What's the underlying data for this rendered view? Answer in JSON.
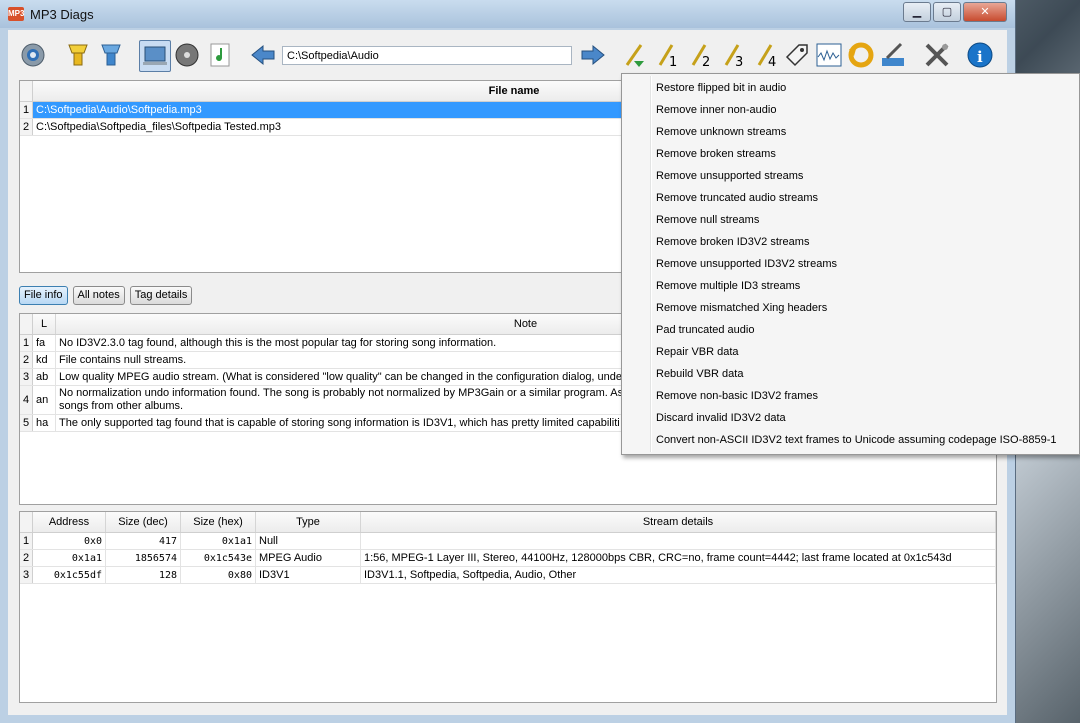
{
  "window": {
    "title": "MP3 Diags",
    "app_icon_text": "MP3"
  },
  "toolbar": {
    "path": "C:\\Softpedia\\Audio",
    "buttons": [
      "config-icon",
      "scan-folder-icon",
      "scan-files-icon",
      "all-files-icon",
      "album-icon",
      "song-icon",
      "back-arrow-icon",
      "forward-arrow-icon",
      "normalize-icon",
      "transform-1-icon",
      "transform-2-icon",
      "transform-3-icon",
      "transform-4-icon",
      "tag-editor-icon",
      "visualize-icon",
      "undo-icon",
      "rename-icon",
      "tools-icon",
      "info-icon"
    ]
  },
  "files": {
    "header": "File name",
    "rows": [
      {
        "n": "1",
        "name": "C:\\Softpedia\\Audio\\Softpedia.mp3"
      },
      {
        "n": "2",
        "name": "C:\\Softpedia\\Softpedia_files\\Softpedia Tested.mp3"
      }
    ]
  },
  "tabs": {
    "file_info": "File info",
    "all_notes": "All notes",
    "tag_details": "Tag details"
  },
  "notes": {
    "headers": {
      "level": "L",
      "note": "Note"
    },
    "rows": [
      {
        "n": "1",
        "l": "fa",
        "note": "No ID3V2.3.0 tag found, although this is the most popular tag for storing song information."
      },
      {
        "n": "2",
        "l": "kd",
        "note": "File contains null streams."
      },
      {
        "n": "3",
        "l": "ab",
        "note": "Low quality MPEG audio stream. (What is considered \"low quality\" can be changed in the configuration dialog, under"
      },
      {
        "n": "4",
        "l": "an",
        "note": "No normalization undo information found. The song is probably not normalized by MP3Gain or a similar program. As a",
        "note2": "songs from other albums."
      },
      {
        "n": "5",
        "l": "ha",
        "note": "The only supported tag found that is capable of storing song information is ID3V1, which has pretty limited capabiliti"
      }
    ]
  },
  "streams": {
    "headers": {
      "address": "Address",
      "size_dec": "Size (dec)",
      "size_hex": "Size (hex)",
      "type": "Type",
      "details": "Stream details"
    },
    "rows": [
      {
        "n": "1",
        "address": "0x0",
        "size_dec": "417",
        "size_hex": "0x1a1",
        "type": "Null",
        "details": ""
      },
      {
        "n": "2",
        "address": "0x1a1",
        "size_dec": "1856574",
        "size_hex": "0x1c543e",
        "type": "MPEG Audio",
        "details": "1:56, MPEG-1 Layer III, Stereo, 44100Hz, 128000bps CBR, CRC=no, frame count=4442; last frame located at 0x1c543d"
      },
      {
        "n": "3",
        "address": "0x1c55df",
        "size_dec": "128",
        "size_hex": "0x80",
        "type": "ID3V1",
        "details": "ID3V1.1, Softpedia, Softpedia, Audio, Other"
      }
    ]
  },
  "menu": {
    "items": [
      "Restore flipped bit in audio",
      "Remove inner non-audio",
      "Remove unknown streams",
      "Remove broken streams",
      "Remove unsupported streams",
      "Remove truncated audio streams",
      "Remove null streams",
      "Remove broken ID3V2 streams",
      "Remove unsupported ID3V2 streams",
      "Remove multiple ID3 streams",
      "Remove mismatched Xing headers",
      "Pad truncated audio",
      "Repair VBR data",
      "Rebuild VBR data",
      "Remove non-basic ID3V2 frames",
      "Discard invalid ID3V2 data",
      "Convert non-ASCII ID3V2 text frames to Unicode assuming codepage ISO-8859-1"
    ]
  },
  "colors": {
    "selection": "#3399ff",
    "accent": "#2f6fb6"
  }
}
